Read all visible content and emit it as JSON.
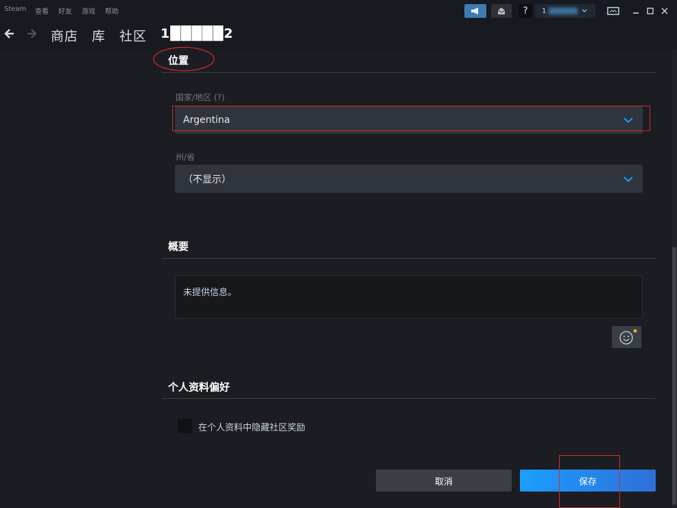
{
  "menu": {
    "items": [
      "Steam",
      "查看",
      "好友",
      "游戏",
      "帮助"
    ]
  },
  "titlebar": {
    "help_label": "?",
    "account_label": "1"
  },
  "nav": {
    "back_icon": "arrow-left-icon",
    "forward_icon": "arrow-right-icon",
    "store": "商店",
    "library": "库",
    "community": "社区",
    "username": "1█████2"
  },
  "location": {
    "title": "位置",
    "country_label": "国家/地区 (?)",
    "country_value": "Argentina",
    "state_label": "州/省",
    "state_value": "（不显示）"
  },
  "summary": {
    "title": "概要",
    "text": "未提供信息。"
  },
  "preferences": {
    "title": "个人资料偏好",
    "hide_awards_label": "在个人资料中隐藏社区奖励",
    "hide_awards_checked": false
  },
  "actions": {
    "cancel_label": "取消",
    "save_label": "保存"
  },
  "colors": {
    "accent": "#1a9fff",
    "annotation": "#d72c2c",
    "chevron": "#1a9fff"
  }
}
